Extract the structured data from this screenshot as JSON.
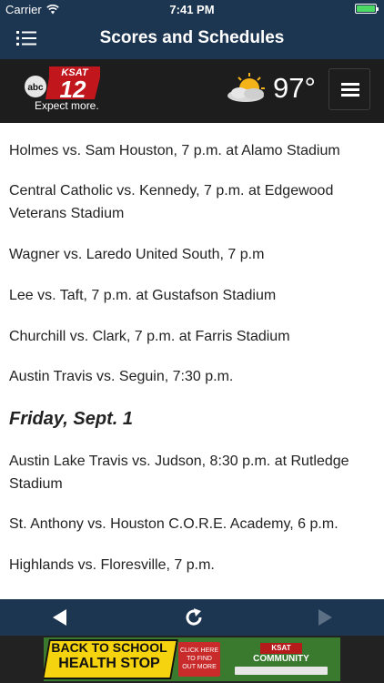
{
  "status_bar": {
    "carrier": "Carrier",
    "time": "7:41 PM",
    "battery_level": 1.0
  },
  "navbar": {
    "title": "Scores and Schedules",
    "menu_icon": "list-icon"
  },
  "banner": {
    "logo_text": "KSAT",
    "logo_network": "abc",
    "logo_number": "12",
    "tagline": "Expect more.",
    "weather_icon": "partly-cloudy-icon",
    "temperature": "97°",
    "menu_icon": "hamburger-icon"
  },
  "schedule": {
    "games_before": [
      "Holmes vs. Sam Houston, 7 p.m. at Alamo Stadium",
      "Central Catholic vs. Kennedy, 7 p.m. at Edgewood Veterans Stadium",
      "Wagner vs. Laredo United South, 7 p.m",
      "Lee vs. Taft, 7 p.m. at Gustafson Stadium",
      "Churchill vs. Clark, 7 p.m. at Farris Stadium",
      "Austin Travis vs. Seguin, 7:30 p.m."
    ],
    "day_heading": "Friday, Sept. 1",
    "games_after": [
      "Austin Lake Travis vs. Judson, 8:30 p.m. at Rutledge Stadium",
      "St. Anthony vs. Houston C.O.R.E. Academy, 6 p.m.",
      "Highlands vs. Floresville, 7 p.m."
    ]
  },
  "toolbar": {
    "back_icon": "back-arrow-icon",
    "refresh_icon": "refresh-icon",
    "forward_icon": "forward-arrow-icon"
  },
  "ad": {
    "sign_line1": "BACK TO SCHOOL",
    "sign_line2": "HEALTH STOP",
    "cta_line1": "CLICK HERE",
    "cta_line2": "TO FIND",
    "cta_line3": "OUT MORE",
    "brand": "KSAT",
    "brand_line": "COMMUNITY"
  },
  "colors": {
    "nav_bg": "#1c3550",
    "banner_bg": "#1d1d1d",
    "text": "#222222",
    "battery": "#4cd964"
  }
}
